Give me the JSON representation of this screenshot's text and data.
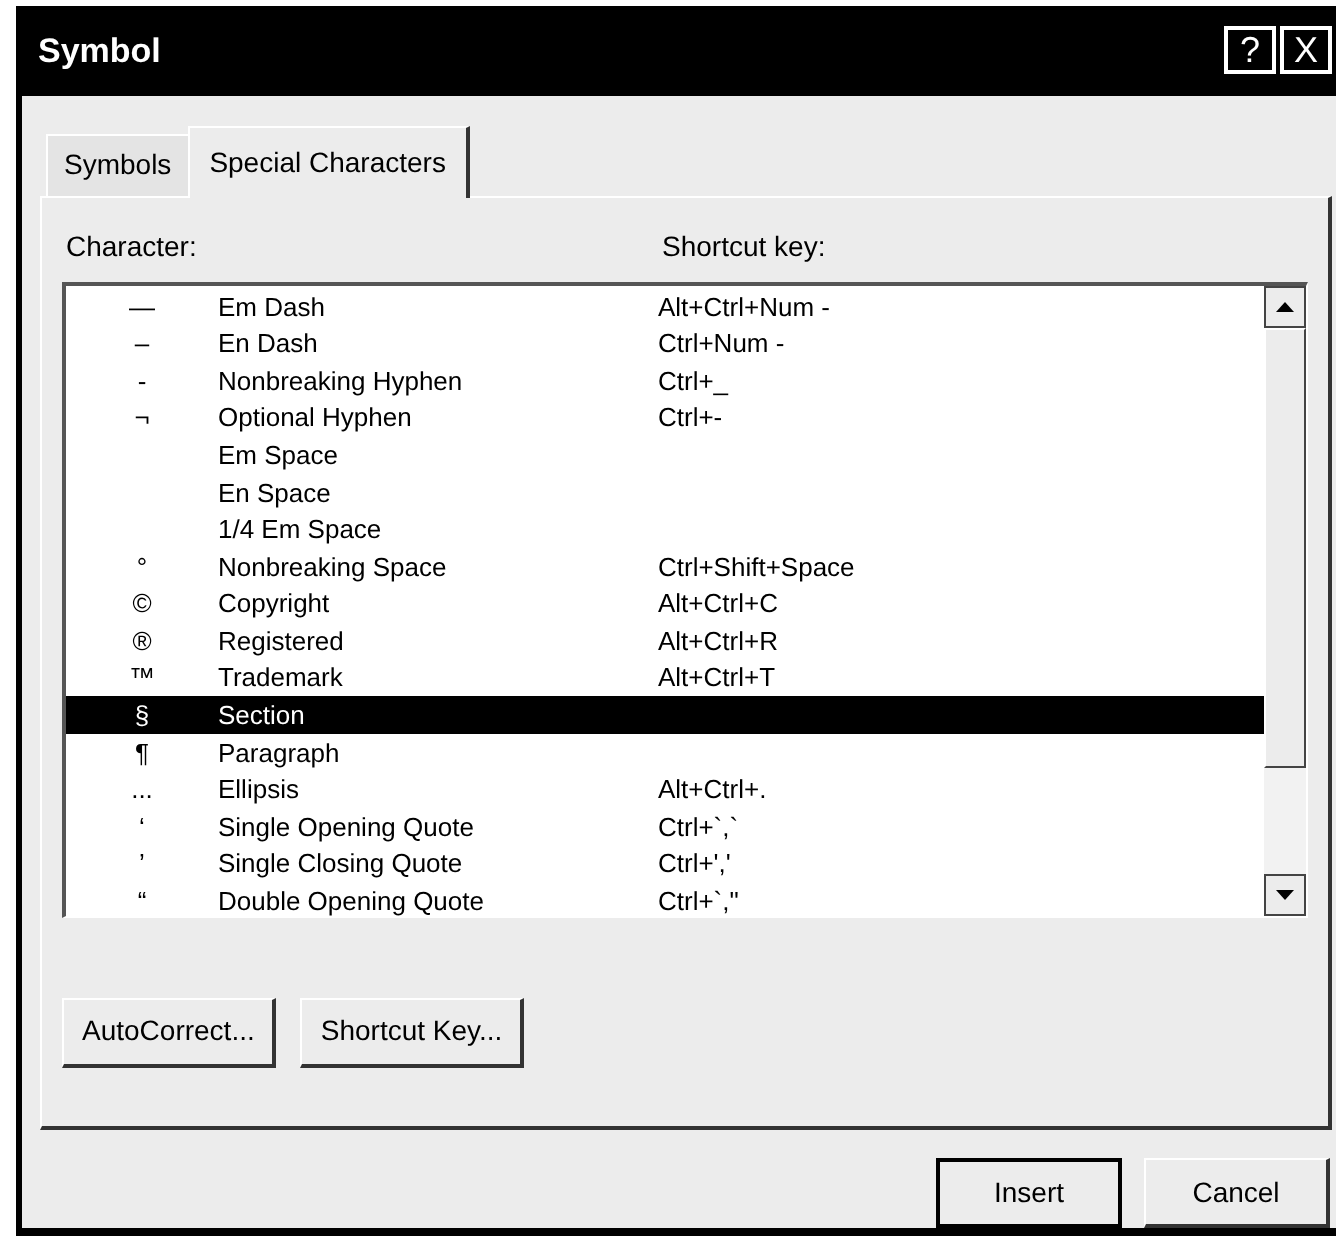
{
  "window": {
    "title": "Symbol",
    "help_button": "?",
    "close_button": "X"
  },
  "tabs": [
    {
      "label": "Symbols",
      "selected": false
    },
    {
      "label": "Special Characters",
      "selected": true
    }
  ],
  "columns": [
    "Character:",
    "Shortcut key:"
  ],
  "rows": [
    {
      "character": "—",
      "name": "Em Dash",
      "shortcut": "Alt+Ctrl+Num -",
      "selected": false
    },
    {
      "character": "–",
      "name": "En Dash",
      "shortcut": "Ctrl+Num -",
      "selected": false
    },
    {
      "character": "-",
      "name": "Nonbreaking Hyphen",
      "shortcut": "Ctrl+_",
      "selected": false
    },
    {
      "character": "¬",
      "name": "Optional Hyphen",
      "shortcut": "Ctrl+-",
      "selected": false
    },
    {
      "character": "",
      "name": "Em Space",
      "shortcut": "",
      "selected": false
    },
    {
      "character": "",
      "name": "En Space",
      "shortcut": "",
      "selected": false
    },
    {
      "character": "",
      "name": "1/4 Em Space",
      "shortcut": "",
      "selected": false
    },
    {
      "character": "°",
      "name": "Nonbreaking Space",
      "shortcut": "Ctrl+Shift+Space",
      "selected": false
    },
    {
      "character": "©",
      "name": "Copyright",
      "shortcut": "Alt+Ctrl+C",
      "selected": false
    },
    {
      "character": "®",
      "name": "Registered",
      "shortcut": "Alt+Ctrl+R",
      "selected": false
    },
    {
      "character": "™",
      "name": "Trademark",
      "shortcut": "Alt+Ctrl+T",
      "selected": false
    },
    {
      "character": "§",
      "name": "Section",
      "shortcut": "",
      "selected": true
    },
    {
      "character": "¶",
      "name": "Paragraph",
      "shortcut": "",
      "selected": false
    },
    {
      "character": "...",
      "name": "Ellipsis",
      "shortcut": "Alt+Ctrl+.",
      "selected": false
    },
    {
      "character": "‘",
      "name": "Single Opening Quote",
      "shortcut": "Ctrl+`,`",
      "selected": false
    },
    {
      "character": "’",
      "name": "Single Closing Quote",
      "shortcut": "Ctrl+','",
      "selected": false
    },
    {
      "character": "“",
      "name": "Double Opening Quote",
      "shortcut": "Ctrl+`,\"",
      "selected": false
    }
  ],
  "panel_buttons": [
    "AutoCorrect...",
    "Shortcut Key..."
  ],
  "dialog_buttons": [
    {
      "label": "Insert",
      "default": true
    },
    {
      "label": "Cancel",
      "default": false
    }
  ]
}
